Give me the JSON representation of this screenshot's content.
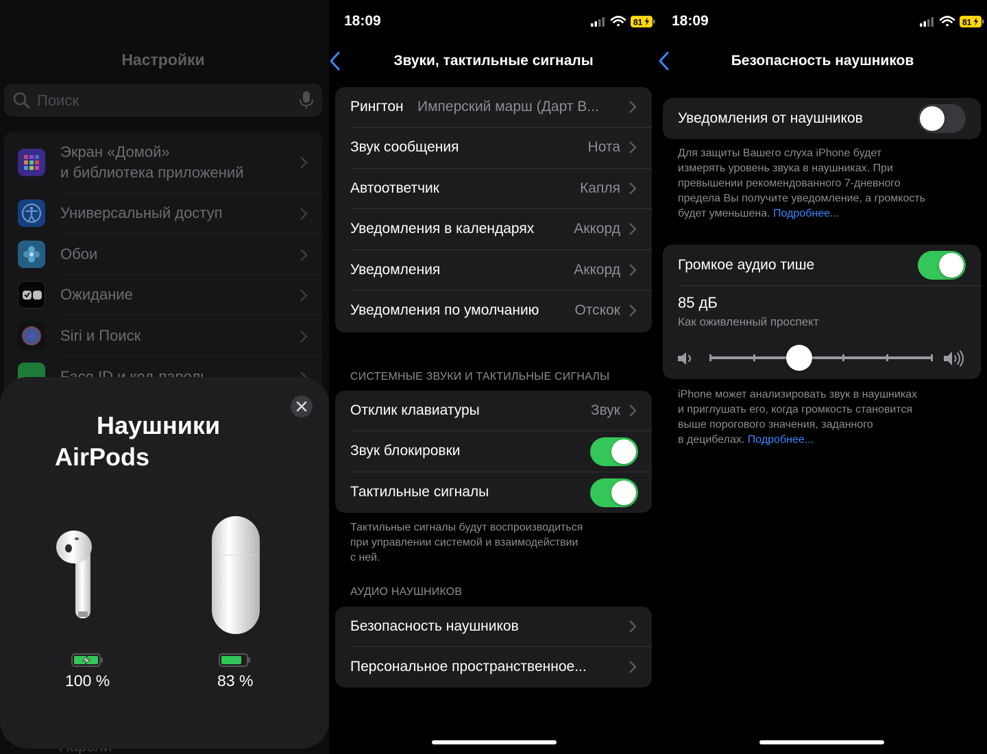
{
  "settings_panel": {
    "title": "Настройки",
    "search_placeholder": "Поиск",
    "items": [
      {
        "label": "Экран «Домой»",
        "label2": "и библиотека приложений",
        "icon": "home-screen-icon",
        "color": "#5b43d6"
      },
      {
        "label": "Универсальный доступ",
        "icon": "accessibility-icon",
        "color": "#1f6fe0"
      },
      {
        "label": "Обои",
        "icon": "wallpaper-icon",
        "color": "#2d9bd6"
      },
      {
        "label": "Ожидание",
        "icon": "standby-icon",
        "color": "#1a1a1a"
      },
      {
        "label": "Siri и Поиск",
        "icon": "siri-icon",
        "color": "#222"
      },
      {
        "label": "Face ID и код-пароль",
        "icon": "faceid-icon",
        "color": "#2fa84f"
      }
    ],
    "bottom_item": "Пароли"
  },
  "airpods_sheet": {
    "title_line1": "Наушники",
    "title_line2": "AirPods",
    "pod_battery": "100 %",
    "case_battery": "83 %",
    "pod_level": 1.0,
    "case_level": 0.83,
    "pod_charging": true
  },
  "status": {
    "time": "18:09",
    "battery": "81"
  },
  "sounds_panel": {
    "title": "Звуки, тактильные сигналы",
    "group1": [
      {
        "label": "Рингтон",
        "value": "Имперский марш (Дарт В..."
      },
      {
        "label": "Звук сообщения",
        "value": "Нота"
      },
      {
        "label": "Автоответчик",
        "value": "Капля"
      },
      {
        "label": "Уведомления в календарях",
        "value": "Аккорд"
      },
      {
        "label": "Уведомления",
        "value": "Аккорд"
      },
      {
        "label": "Уведомления по умолчанию",
        "value": "Отскок"
      }
    ],
    "section2_header": "СИСТЕМНЫЕ ЗВУКИ И ТАКТИЛЬНЫЕ СИГНАЛЫ",
    "group2": {
      "keyboard_label": "Отклик клавиатуры",
      "keyboard_value": "Звук",
      "lock_label": "Звук блокировки",
      "lock_on": true,
      "haptics_label": "Тактильные сигналы",
      "haptics_on": true
    },
    "section2_footer": [
      "Тактильные сигналы будут воспроизводиться",
      "при управлении системой и взаимодействии",
      "с ней."
    ],
    "section3_header": "АУДИО НАУШНИКОВ",
    "group3": [
      {
        "label": "Безопасность наушников"
      },
      {
        "label": "Персональное пространственное..."
      }
    ]
  },
  "safety_panel": {
    "title": "Безопасность наушников",
    "notifications_label": "Уведомления от наушников",
    "notifications_on": false,
    "notifications_footer": [
      "Для защиты Вашего слуха iPhone будет",
      "измерять уровень звука в наушниках. При",
      "превышении рекомендованного 7-дневного",
      "предела Вы получите уведомление, а громкость"
    ],
    "notifications_footer_last": "будет уменьшена.",
    "more_link": "Подробнее...",
    "reduce_label": "Громкое аудио тише",
    "reduce_on": true,
    "db_value": "85 дБ",
    "db_desc": "Как оживленный проспект",
    "slider_position": 0.4,
    "reduce_footer": [
      "iPhone может анализировать звук в наушниках",
      "и приглушать его, когда громкость становится",
      "выше порогового значения, заданного"
    ],
    "reduce_footer_last": "в децибелах.",
    "more_link2": "Подробнее..."
  }
}
